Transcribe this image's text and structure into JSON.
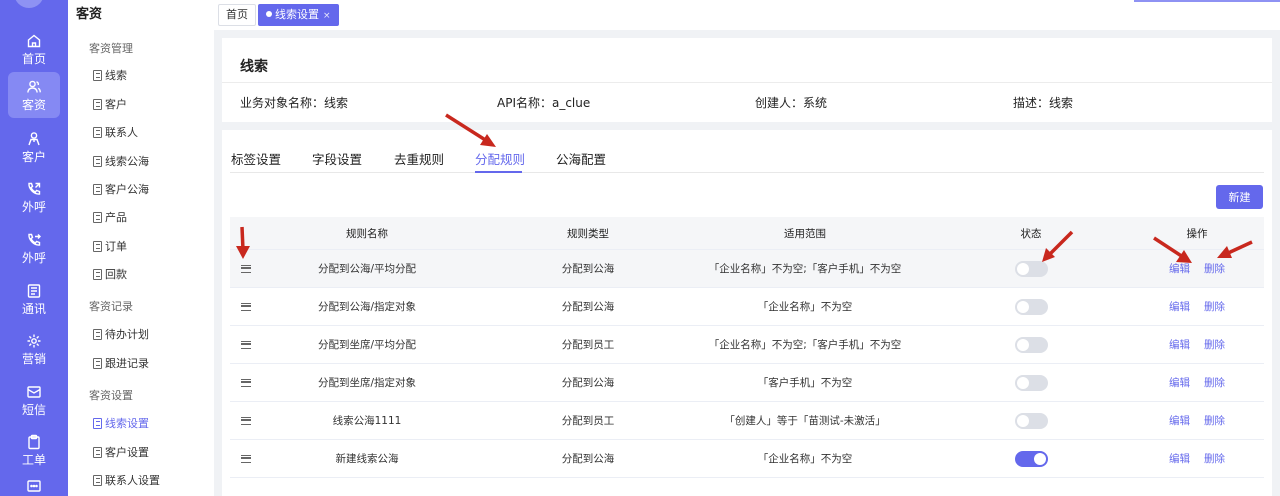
{
  "rail": {
    "items": [
      {
        "label": "首页",
        "icon": "home-icon"
      },
      {
        "label": "客资",
        "icon": "customer-resource-icon"
      },
      {
        "label": "客户",
        "icon": "person-icon"
      },
      {
        "label": "外呼",
        "icon": "phone-out-icon"
      },
      {
        "label": "外呼",
        "icon": "phone-forward-icon"
      },
      {
        "label": "通讯",
        "icon": "contacts-icon"
      },
      {
        "label": "营销",
        "icon": "marketing-icon"
      },
      {
        "label": "短信",
        "icon": "message-icon"
      },
      {
        "label": "工单",
        "icon": "clipboard-icon"
      }
    ]
  },
  "menu": {
    "title": "客资",
    "group1": "客资管理",
    "group2": "客资记录",
    "group3": "客资设置",
    "items": [
      "线索",
      "客户",
      "联系人",
      "线索公海",
      "客户公海",
      "产品",
      "订单",
      "回款",
      "待办计划",
      "跟进记录",
      "线索设置",
      "客户设置",
      "联系人设置"
    ]
  },
  "pagetabs": {
    "home": "首页",
    "current": "线索设置",
    "close": "×"
  },
  "info": {
    "title": "线索",
    "object_name": "业务对象名称：线索",
    "api_name": "API名称：a_clue",
    "creator": "创建人：系统",
    "description": "描述：线索"
  },
  "tabs": [
    "标签设置",
    "字段设置",
    "去重规则",
    "分配规则",
    "公海配置"
  ],
  "new_button": "新建",
  "table": {
    "headers": [
      "规则名称",
      "规则类型",
      "适用范围",
      "状态",
      "操作"
    ],
    "edit_label": "编辑",
    "delete_label": "删除",
    "rows": [
      {
        "name": "分配到公海/平均分配",
        "type": "分配到公海",
        "scope": "「企业名称」不为空;「客户手机」不为空",
        "enabled": false
      },
      {
        "name": "分配到公海/指定对象",
        "type": "分配到公海",
        "scope": "「企业名称」不为空",
        "enabled": false
      },
      {
        "name": "分配到坐席/平均分配",
        "type": "分配到员工",
        "scope": "「企业名称」不为空;「客户手机」不为空",
        "enabled": false
      },
      {
        "name": "分配到坐席/指定对象",
        "type": "分配到公海",
        "scope": "「客户手机」不为空",
        "enabled": false
      },
      {
        "name": "线索公海1111",
        "type": "分配到员工",
        "scope": "「创建人」等于「苗测试-未激活」",
        "enabled": false
      },
      {
        "name": "新建线索公海",
        "type": "分配到公海",
        "scope": "「企业名称」不为空",
        "enabled": true
      }
    ]
  },
  "colors": {
    "accent": "#6468ec",
    "annotation": "#c8281e"
  }
}
